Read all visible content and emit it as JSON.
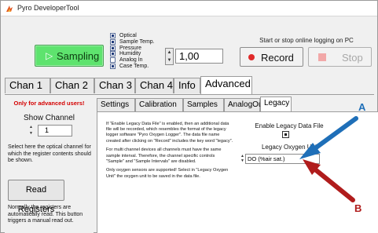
{
  "window": {
    "title": "Pyro DeveloperTool"
  },
  "toolbar": {
    "sampling_label": "Sampling",
    "sensors": [
      {
        "label": "Optical",
        "checked": true
      },
      {
        "label": "Sample Temp.",
        "checked": true
      },
      {
        "label": "Pressure",
        "checked": true
      },
      {
        "label": "Humidity",
        "checked": true
      },
      {
        "label": "Analog In",
        "checked": false
      },
      {
        "label": "Case Temp.",
        "checked": true
      }
    ],
    "interval_value": "1,00",
    "online_hint": "Start or stop online logging on PC",
    "record_label": "Record",
    "stop_label": "Stop",
    "stop_enabled": false
  },
  "main_tabs": [
    "Chan 1",
    "Chan 2",
    "Chan 3",
    "Chan 4",
    "Info",
    "Advanced"
  ],
  "main_tab_active": "Advanced",
  "left_panel": {
    "warning": "Only for advanced users!",
    "show_channel_label": "Show Channel",
    "channel_value": "1",
    "channel_help": "Select here the optical channel for which the register contents should be shown.",
    "read_registers_label": "Read Registers",
    "registers_help": "Normally the registers are automatically read. This button triggers a manual read out."
  },
  "sub_tabs": [
    "Settings",
    "Calibration",
    "Samples",
    "AnalogOut",
    "Legacy"
  ],
  "sub_tab_active": "Legacy",
  "legacy": {
    "para1": "If \"Enable Legacy Data File\" is enabled, then an additional data file will be recorded, which resembles the format of the legacy logger software \"Pyro Oxygen Logger\". The data file name created after clicking on \"Record\" includes the key word \"legacy\".",
    "para2": "For multi channel devices all channels must have the same sample interval. Therefore, the channel specific controls \"Sample\" and \"Sample Intervals\" are disabled.",
    "para3": "Only oxygen sensors are supported! Select in \"Legacy Oxygen Unit\" the oxygen unit to be saved in the data file.",
    "enable_label": "Enable Legacy Data File",
    "enable_checked": true,
    "unit_label": "Legacy Oxygen Unit",
    "unit_value": "DO (%air sat.)"
  },
  "annotations": {
    "a_label": "A",
    "a_color": "#1f6fb8",
    "b_label": "B",
    "b_color": "#b01c1c"
  },
  "colors": {
    "sampling_green": "#5ee36e",
    "record_red": "#e02a2a",
    "warning_red": "#d40000"
  }
}
